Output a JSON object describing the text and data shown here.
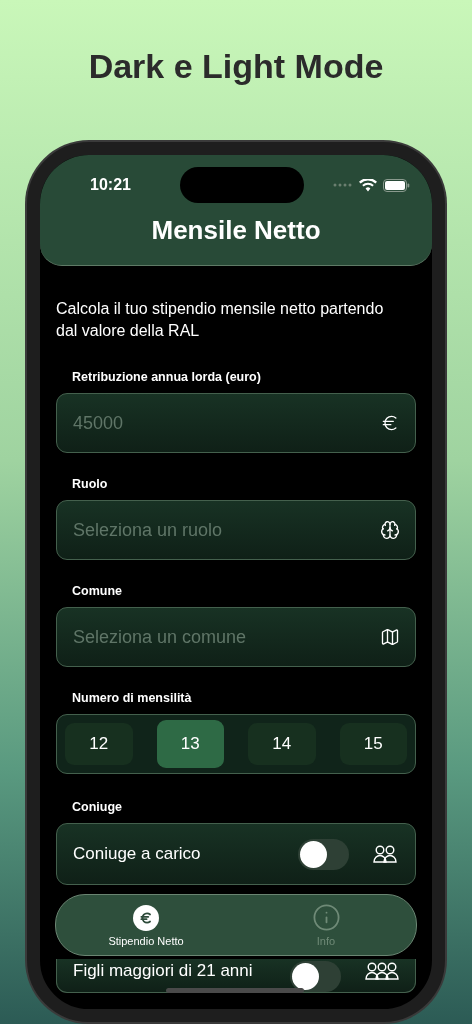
{
  "page_title": "Dark e Light Mode",
  "status_bar": {
    "time": "10:21"
  },
  "nav_title": "Mensile Netto",
  "intro": "Calcola il tuo stipendio mensile netto partendo dal valore della RAL",
  "fields": [
    {
      "label": "Retribuzione annua lorda (euro)",
      "placeholder": "45000"
    },
    {
      "label": "Ruolo",
      "placeholder": "Seleziona un ruolo"
    },
    {
      "label": "Comune",
      "placeholder": "Seleziona un comune"
    }
  ],
  "months": {
    "label": "Numero di mensilità",
    "options": [
      {
        "label": "12",
        "selected": false
      },
      {
        "label": "13",
        "selected": true
      },
      {
        "label": "14",
        "selected": false
      },
      {
        "label": "15",
        "selected": false
      }
    ]
  },
  "spouse": {
    "label": "Coniuge",
    "toggle": {
      "label": "Coniuge a carico",
      "on": false
    }
  },
  "children": {
    "toggle": {
      "label": "Figli maggiori di 21 anni",
      "on": false
    }
  },
  "tab_bar": [
    {
      "label": "Stipendio Netto",
      "selected": true
    },
    {
      "label": "Info",
      "selected": false
    }
  ]
}
